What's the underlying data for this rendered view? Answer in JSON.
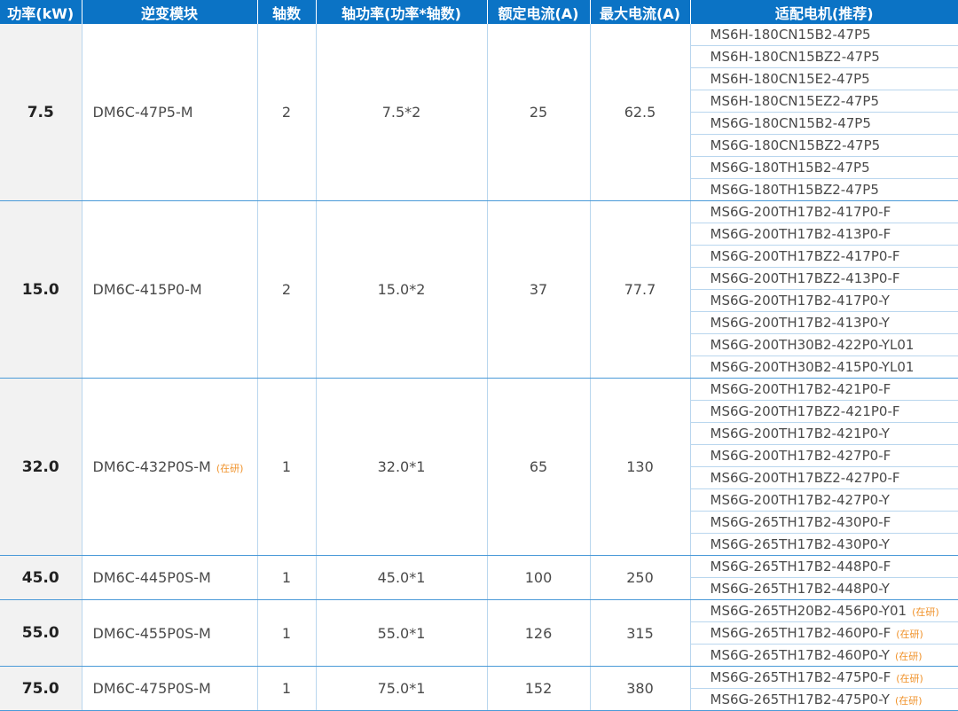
{
  "headers": [
    "功率(kW)",
    "逆变模块",
    "轴数",
    "轴功率(功率*轴数)",
    "额定电流(A)",
    "最大电流(A)",
    "适配电机(推荐)"
  ],
  "groups": [
    {
      "power": "7.5",
      "module": "DM6C-47P5-M",
      "module_tag": "",
      "axes": "2",
      "axis_power": "7.5*2",
      "rated_current": "25",
      "max_current": "62.5",
      "motors": [
        {
          "name": "MS6H-180CN15B2-47P5",
          "tag": ""
        },
        {
          "name": "MS6H-180CN15BZ2-47P5",
          "tag": ""
        },
        {
          "name": "MS6H-180CN15E2-47P5",
          "tag": ""
        },
        {
          "name": "MS6H-180CN15EZ2-47P5",
          "tag": ""
        },
        {
          "name": "MS6G-180CN15B2-47P5",
          "tag": ""
        },
        {
          "name": "MS6G-180CN15BZ2-47P5",
          "tag": ""
        },
        {
          "name": "MS6G-180TH15B2-47P5",
          "tag": ""
        },
        {
          "name": "MS6G-180TH15BZ2-47P5",
          "tag": ""
        }
      ]
    },
    {
      "power": "15.0",
      "module": "DM6C-415P0-M",
      "module_tag": "",
      "axes": "2",
      "axis_power": "15.0*2",
      "rated_current": "37",
      "max_current": "77.7",
      "motors": [
        {
          "name": "MS6G-200TH17B2-417P0-F",
          "tag": ""
        },
        {
          "name": "MS6G-200TH17B2-413P0-F",
          "tag": ""
        },
        {
          "name": "MS6G-200TH17BZ2-417P0-F",
          "tag": ""
        },
        {
          "name": "MS6G-200TH17BZ2-413P0-F",
          "tag": ""
        },
        {
          "name": "MS6G-200TH17B2-417P0-Y",
          "tag": ""
        },
        {
          "name": "MS6G-200TH17B2-413P0-Y",
          "tag": ""
        },
        {
          "name": "MS6G-200TH30B2-422P0-YL01",
          "tag": ""
        },
        {
          "name": "MS6G-200TH30B2-415P0-YL01",
          "tag": ""
        }
      ]
    },
    {
      "power": "32.0",
      "module": "DM6C-432P0S-M",
      "module_tag": "(在研)",
      "axes": "1",
      "axis_power": "32.0*1",
      "rated_current": "65",
      "max_current": "130",
      "motors": [
        {
          "name": "MS6G-200TH17B2-421P0-F",
          "tag": ""
        },
        {
          "name": "MS6G-200TH17BZ2-421P0-F",
          "tag": ""
        },
        {
          "name": "MS6G-200TH17B2-421P0-Y",
          "tag": ""
        },
        {
          "name": "MS6G-200TH17B2-427P0-F",
          "tag": ""
        },
        {
          "name": "MS6G-200TH17BZ2-427P0-F",
          "tag": ""
        },
        {
          "name": "MS6G-200TH17B2-427P0-Y",
          "tag": ""
        },
        {
          "name": "MS6G-265TH17B2-430P0-F",
          "tag": ""
        },
        {
          "name": "MS6G-265TH17B2-430P0-Y",
          "tag": ""
        }
      ]
    },
    {
      "power": "45.0",
      "module": "DM6C-445P0S-M",
      "module_tag": "",
      "axes": "1",
      "axis_power": "45.0*1",
      "rated_current": "100",
      "max_current": "250",
      "motors": [
        {
          "name": "MS6G-265TH17B2-448P0-F",
          "tag": ""
        },
        {
          "name": "MS6G-265TH17B2-448P0-Y",
          "tag": ""
        }
      ]
    },
    {
      "power": "55.0",
      "module": "DM6C-455P0S-M",
      "module_tag": "",
      "axes": "1",
      "axis_power": "55.0*1",
      "rated_current": "126",
      "max_current": "315",
      "motors": [
        {
          "name": "MS6G-265TH20B2-456P0-Y01",
          "tag": "(在研)"
        },
        {
          "name": "MS6G-265TH17B2-460P0-F",
          "tag": "(在研)"
        },
        {
          "name": "MS6G-265TH17B2-460P0-Y",
          "tag": "(在研)"
        }
      ]
    },
    {
      "power": "75.0",
      "module": "DM6C-475P0S-M",
      "module_tag": "",
      "axes": "1",
      "axis_power": "75.0*1",
      "rated_current": "152",
      "max_current": "380",
      "motors": [
        {
          "name": "MS6G-265TH17B2-475P0-F",
          "tag": "(在研)"
        },
        {
          "name": "MS6G-265TH17B2-475P0-Y",
          "tag": "(在研)"
        }
      ]
    }
  ],
  "colors": {
    "header_bg": "#0b73c5",
    "header_text": "#ffffff",
    "power_col_bg": "#f2f2f2",
    "tag_text": "#f0922a",
    "rule": "#4a9ad8"
  }
}
